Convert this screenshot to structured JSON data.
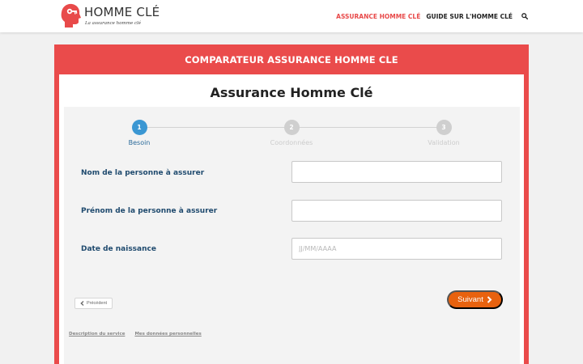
{
  "header": {
    "logo_title": "HOMME CLÉ",
    "logo_tagline": "La assurance homme clé",
    "nav": [
      {
        "label": "ASSURANCE HOMME CLÉ",
        "active": true
      },
      {
        "label": "GUIDE SUR L'HOMME CLÉ",
        "active": false
      }
    ],
    "search_icon": "search-icon",
    "brand_color": "#e84a4a"
  },
  "card": {
    "title": "COMPARATEUR ASSURANCE HOMME CLE",
    "background_color": "#ea4b4b",
    "form_title": "Assurance Homme Clé"
  },
  "steps": [
    {
      "number": "1",
      "label": "Besoin",
      "status": "active"
    },
    {
      "number": "2",
      "label": "Coordonnées",
      "status": "inactive"
    },
    {
      "number": "3",
      "label": "Validation",
      "status": "inactive"
    }
  ],
  "step_colors": {
    "active": "#3b97d3",
    "inactive": "#cfcfcf",
    "active_label": "#2a6a9a",
    "inactive_label": "#cccccc"
  },
  "fields": [
    {
      "label": "Nom de la personne à assurer",
      "value": "",
      "placeholder": ""
    },
    {
      "label": "Prénom de la personne à assurer",
      "value": "",
      "placeholder": ""
    },
    {
      "label": "Date de naissance",
      "value": "",
      "placeholder": "JJ/MM/AAAA"
    }
  ],
  "buttons": {
    "prev_label": "Précédent",
    "prev_icon": "chevron-left-icon",
    "next_label": "Suivant",
    "next_icon": "chevron-right-icon",
    "next_color": "#e8620f"
  },
  "footer": {
    "links": [
      "Description du service",
      "Mes données personnelles"
    ]
  }
}
